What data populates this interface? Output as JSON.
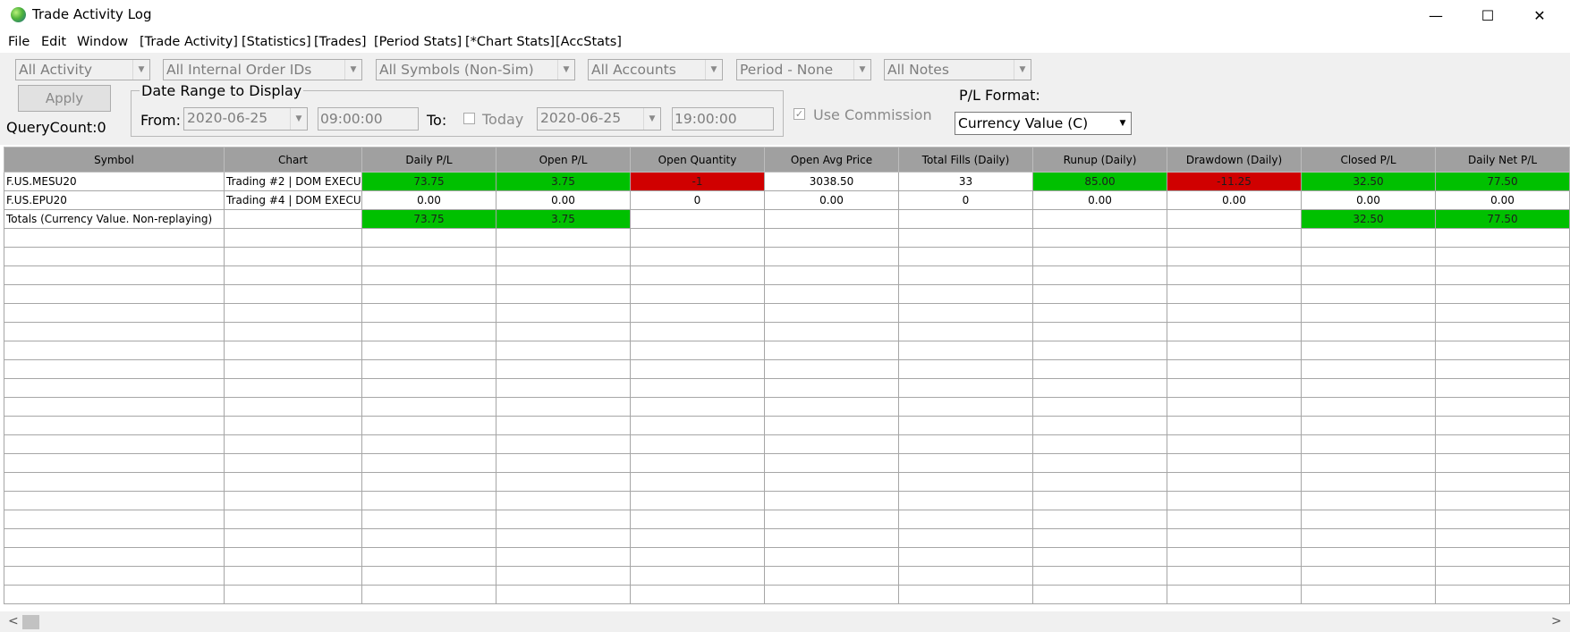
{
  "window": {
    "title": "Trade Activity Log",
    "controls": {
      "minimize": "—",
      "maximize": "☐",
      "close": "✕"
    }
  },
  "menu": [
    "File",
    "Edit",
    "Window",
    "[Trade Activity]",
    "[Statistics]",
    "[Trades]",
    "[Period Stats]",
    "[*Chart Stats]",
    "[AccStats]"
  ],
  "filters": {
    "activity": "All Activity",
    "order_ids": "All Internal Order IDs",
    "symbols": "All Symbols (Non-Sim)",
    "accounts": "All Accounts",
    "period": "Period - None",
    "notes": "All Notes"
  },
  "apply_label": "Apply",
  "query_count": "QueryCount:0",
  "date_range": {
    "title": "Date Range to Display",
    "from_label": "From:",
    "from_date": "2020-06-25",
    "from_time": "09:00:00",
    "to_label": "To:",
    "today_label": "Today",
    "to_date": "2020-06-25",
    "to_time": "19:00:00"
  },
  "use_commission": {
    "label": "Use Commission",
    "checked": true
  },
  "pl_format": {
    "label": "P/L Format:",
    "value": "Currency Value (C)"
  },
  "table": {
    "columns": [
      "Symbol",
      "Chart",
      "Daily P/L",
      "Open P/L",
      "Open Quantity",
      "Open Avg Price",
      "Total Fills (Daily)",
      "Runup (Daily)",
      "Drawdown (Daily)",
      "Closed P/L",
      "Daily Net P/L"
    ],
    "rows": [
      [
        "F.US.MESU20",
        "Trading  #2 | DOM EXECU",
        "73.75",
        "3.75",
        "-1",
        "3038.50",
        "33",
        "85.00",
        "-11.25",
        "32.50",
        "77.50"
      ],
      [
        "F.US.EPU20",
        "Trading  #4 | DOM EXECU",
        "0.00",
        "0.00",
        "0",
        "0.00",
        "0",
        "0.00",
        "0.00",
        "0.00",
        "0.00"
      ],
      [
        "Totals (Currency Value. Non-replaying)",
        "",
        "73.75",
        "3.75",
        "",
        "",
        "",
        "",
        "",
        "32.50",
        "77.50"
      ]
    ],
    "cell_colors": [
      [
        "",
        "",
        "pos",
        "pos",
        "neg",
        "",
        "",
        "pos",
        "neg",
        "pos",
        "pos"
      ],
      [
        "",
        "",
        "",
        "",
        "",
        "",
        "",
        "",
        "",
        "",
        ""
      ],
      [
        "",
        "",
        "pos",
        "pos",
        "",
        "",
        "",
        "",
        "",
        "pos",
        "pos"
      ]
    ],
    "empty_rows": 20
  },
  "colors": {
    "positive": "#00c000",
    "negative": "#d00000",
    "header": "#a0a0a0"
  }
}
